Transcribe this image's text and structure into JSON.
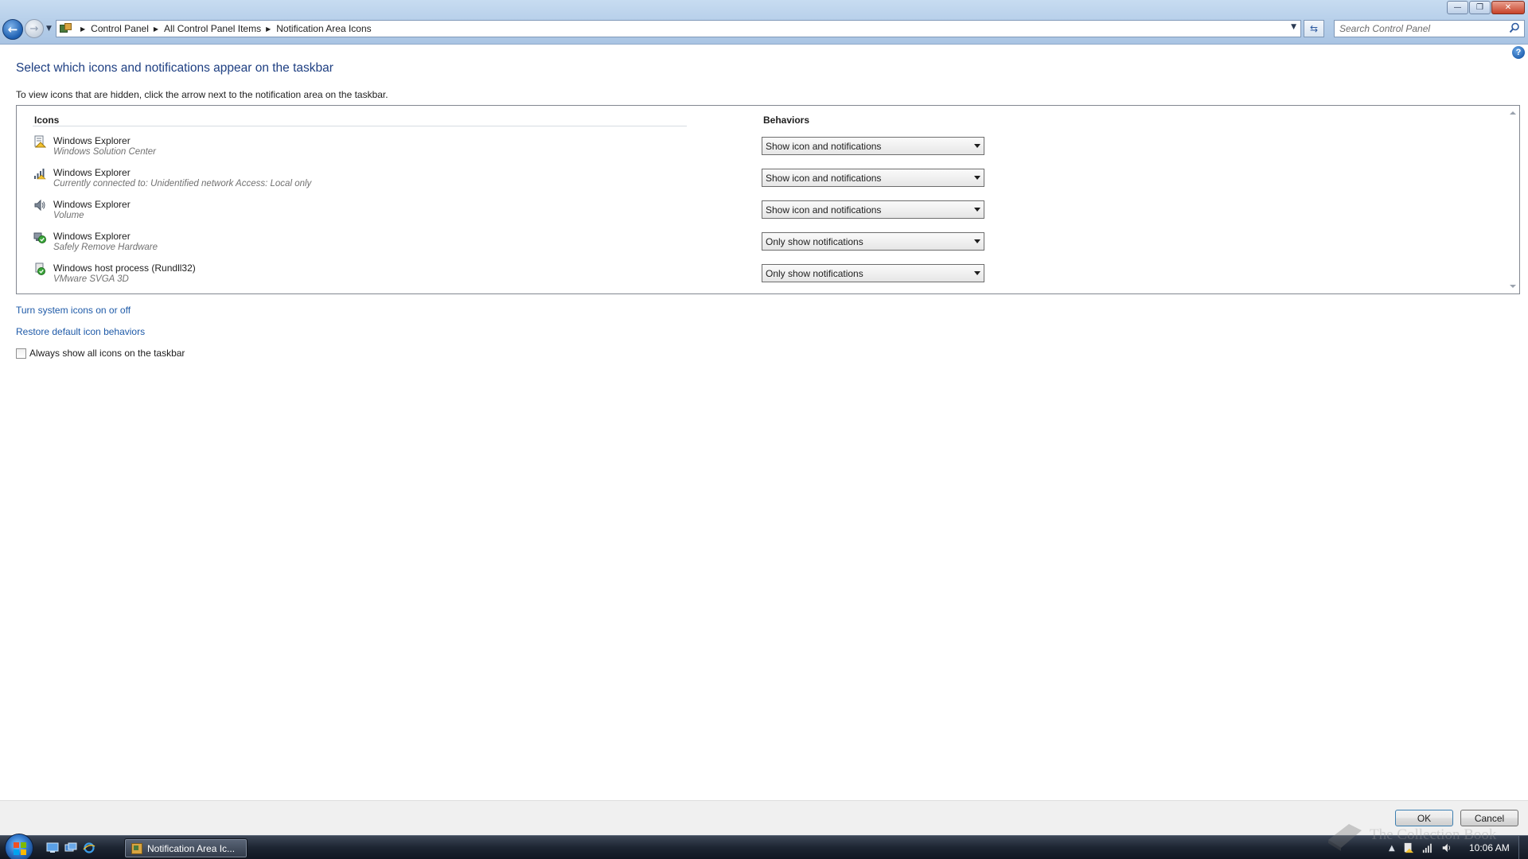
{
  "window": {
    "controls": {
      "minimize": "—",
      "maximize": "❐",
      "close": "✕"
    }
  },
  "address_bar": {
    "breadcrumbs": [
      "Control Panel",
      "All Control Panel Items",
      "Notification Area Icons"
    ],
    "search_placeholder": "Search Control Panel"
  },
  "page": {
    "title": "Select which icons and notifications appear on the taskbar",
    "instructions": "To view icons that are hidden, click the arrow next to the notification area on the taskbar.",
    "columns": {
      "icons": "Icons",
      "behaviors": "Behaviors"
    },
    "rows": [
      {
        "icon": "action-center-icon",
        "title": "Windows Explorer",
        "subtitle": "Windows Solution Center",
        "behavior": "Show icon and notifications"
      },
      {
        "icon": "network-icon",
        "title": "Windows Explorer",
        "subtitle": "Currently connected to: Unidentified network Access:  Local only",
        "behavior": "Show icon and notifications"
      },
      {
        "icon": "volume-icon",
        "title": "Windows Explorer",
        "subtitle": "Volume",
        "behavior": "Show icon and notifications"
      },
      {
        "icon": "safely-remove-hardware-icon",
        "title": "Windows Explorer",
        "subtitle": "Safely Remove Hardware",
        "behavior": "Only show notifications"
      },
      {
        "icon": "vmware-svga-icon",
        "title": "Windows host process (Rundll32)",
        "subtitle": "VMware SVGA 3D",
        "behavior": "Only show notifications"
      }
    ],
    "links": {
      "turn_system_icons": "Turn system icons on or off",
      "restore_defaults": "Restore default icon behaviors"
    },
    "always_show_label": "Always show all icons on the taskbar",
    "always_show_checked": false
  },
  "buttons": {
    "ok": "OK",
    "cancel": "Cancel"
  },
  "taskbar": {
    "active_window": "Notification Area Ic...",
    "clock": "10:06 AM"
  },
  "watermark": "The Collection Book",
  "colors": {
    "title_blue": "#1e3f82",
    "link_blue": "#1e5aa8",
    "subtitle_gray": "#717171"
  }
}
